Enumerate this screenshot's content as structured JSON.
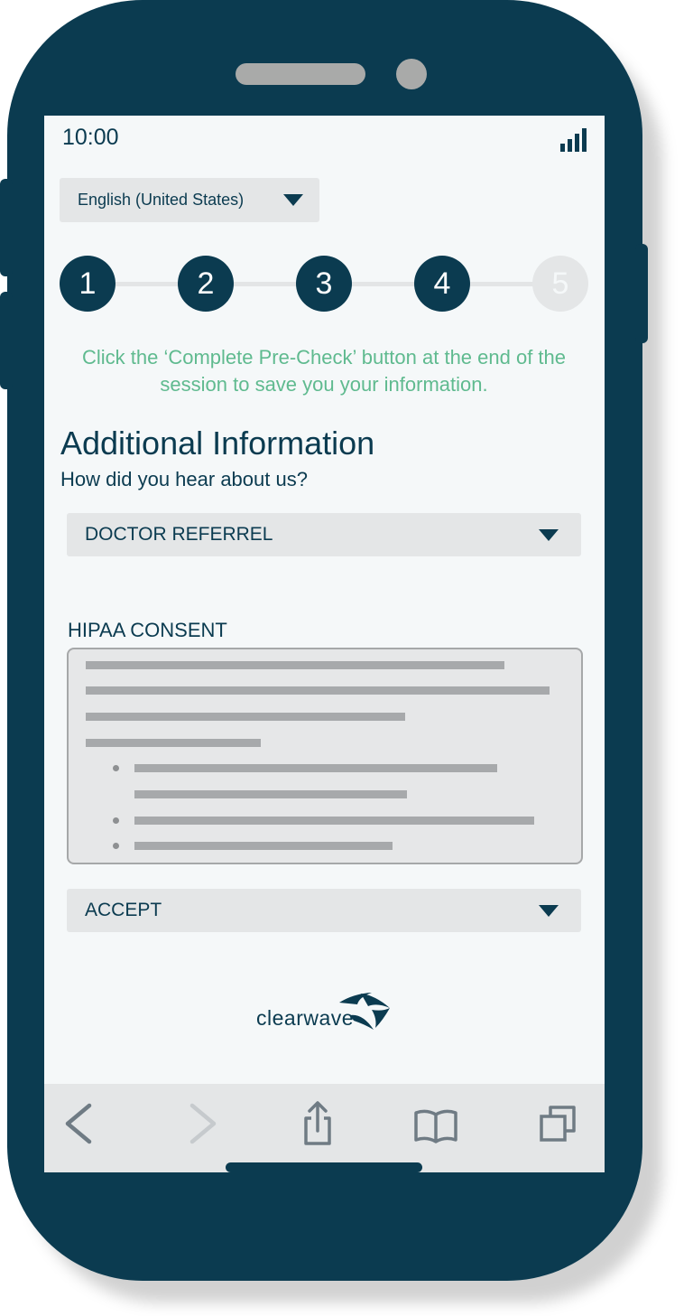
{
  "status_bar": {
    "time": "10:00"
  },
  "language": {
    "selected": "English (United States)"
  },
  "stepper": {
    "steps": [
      {
        "label": "1",
        "state": "complete"
      },
      {
        "label": "2",
        "state": "complete"
      },
      {
        "label": "3",
        "state": "complete"
      },
      {
        "label": "4",
        "state": "complete"
      },
      {
        "label": "5",
        "state": "inactive"
      }
    ]
  },
  "notice": "Click the ‘Complete Pre-Check’ button at the end of the session to save you your information.",
  "page": {
    "title": "Additional Information",
    "question": "How did you hear about us?"
  },
  "referral_select": {
    "value": "DOCTOR REFERREL"
  },
  "hipaa": {
    "label": "HIPAA CONSENT"
  },
  "consent_select": {
    "value": "ACCEPT"
  },
  "logo": {
    "text": "clearwave"
  },
  "colors": {
    "brand_navy": "#0b3b50",
    "accent_green": "#5fba8f",
    "field_gray": "#e4e6e7",
    "screen_bg": "#f5f8f9"
  },
  "toolbar": {
    "icons": [
      "back-icon",
      "forward-icon",
      "share-icon",
      "bookmarks-icon",
      "tabs-icon"
    ]
  }
}
